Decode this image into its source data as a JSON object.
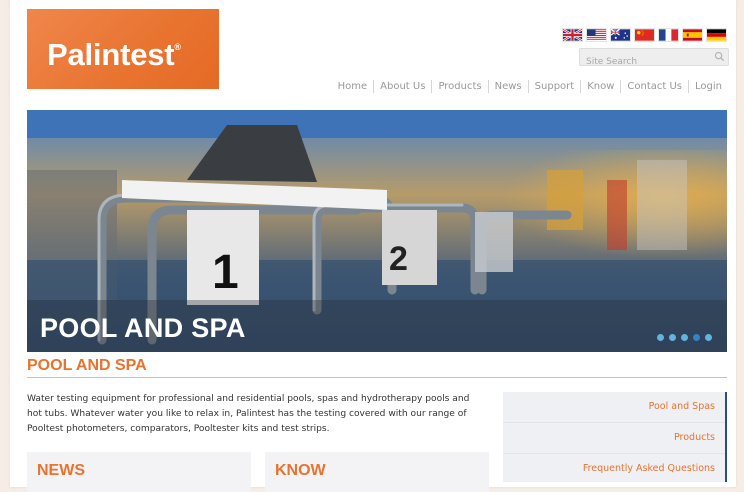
{
  "logo": {
    "text": "Palintest",
    "mark": "®"
  },
  "flags": [
    "uk-flag-icon",
    "us-flag-icon",
    "au-flag-icon",
    "cn-flag-icon",
    "fr-flag-icon",
    "es-flag-icon",
    "de-flag-icon"
  ],
  "search": {
    "placeholder": "Site Search",
    "icon": "search-icon"
  },
  "nav": {
    "items": [
      "Home",
      "About Us",
      "Products",
      "News",
      "Support",
      "Know",
      "Contact Us",
      "Login"
    ]
  },
  "hero": {
    "caption": "POOL AND SPA",
    "lane_numbers": [
      "1",
      "2"
    ],
    "slides": 5,
    "active_slide": 4
  },
  "section": {
    "title": "POOL AND SPA",
    "intro": "Water testing equipment for professional and residential pools, spas and hydrotherapy pools and hot tubs. Whatever water you like to relax in, Palintest has the testing covered with our range of Pooltest photometers, comparators, Pooltester kits and test strips."
  },
  "boxes": {
    "news_title": "NEWS",
    "know_title": "KNOW"
  },
  "sidebar": {
    "links": [
      "Pool and Spas",
      "Products",
      "Frequently Asked Questions"
    ]
  },
  "colors": {
    "brand_orange": "#e8732f",
    "link_blue": "#2a4d8a",
    "dot_blue": "#5fb5e0"
  }
}
